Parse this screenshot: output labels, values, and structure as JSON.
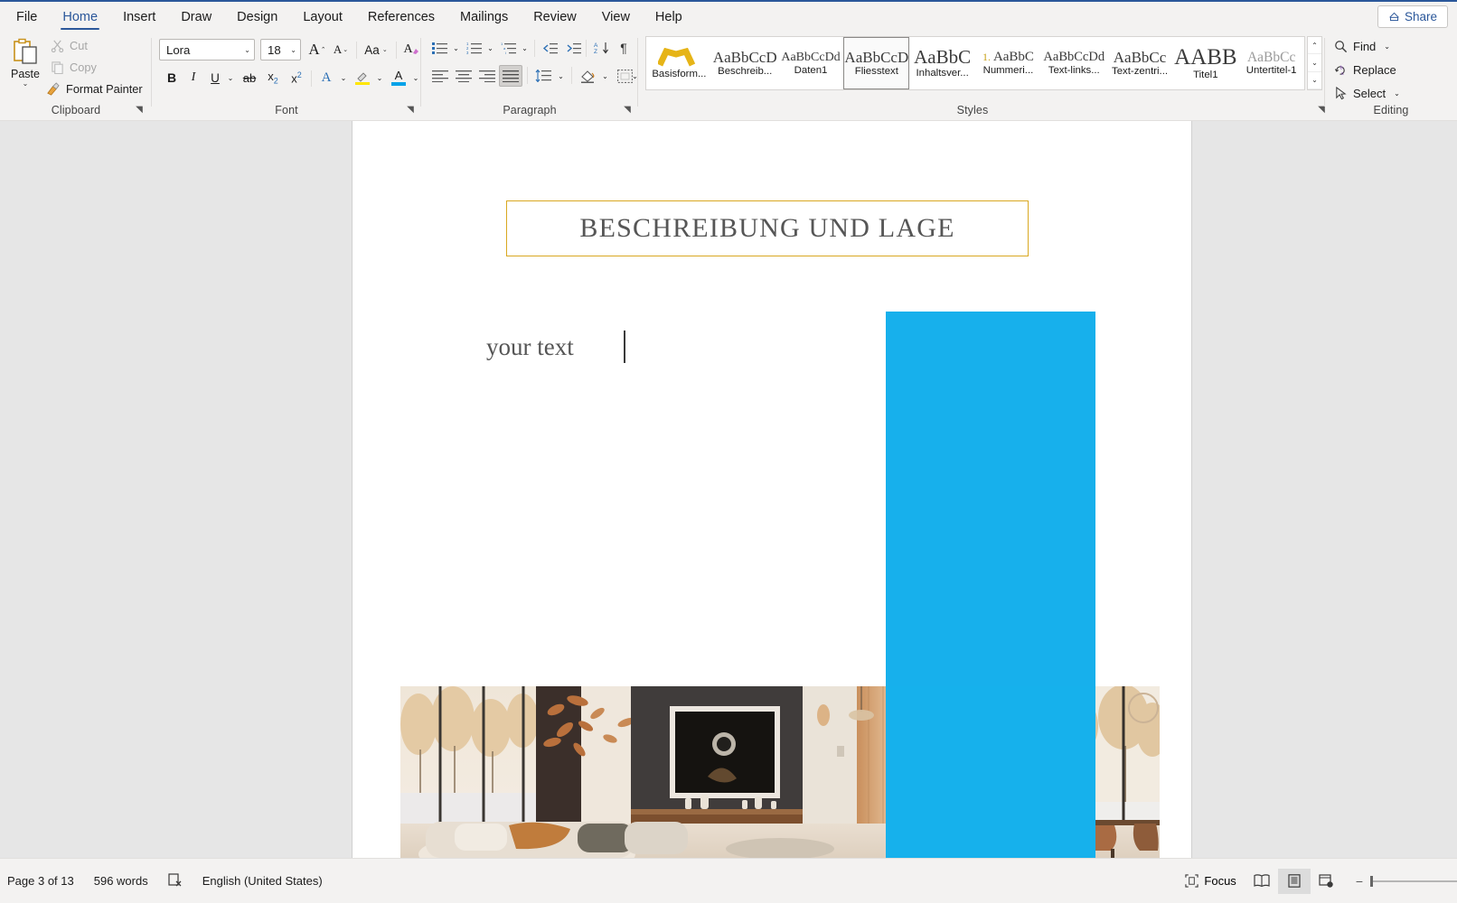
{
  "titlebar": {
    "tabs": [
      {
        "label": "File",
        "active": false
      },
      {
        "label": "Home",
        "active": true
      },
      {
        "label": "Insert",
        "active": false
      },
      {
        "label": "Draw",
        "active": false
      },
      {
        "label": "Design",
        "active": false
      },
      {
        "label": "Layout",
        "active": false
      },
      {
        "label": "References",
        "active": false
      },
      {
        "label": "Mailings",
        "active": false
      },
      {
        "label": "Review",
        "active": false
      },
      {
        "label": "View",
        "active": false
      },
      {
        "label": "Help",
        "active": false
      }
    ],
    "share_label": "Share"
  },
  "ribbon": {
    "clipboard": {
      "group_label": "Clipboard",
      "paste_label": "Paste",
      "cut_label": "Cut",
      "copy_label": "Copy",
      "format_painter_label": "Format Painter"
    },
    "font": {
      "group_label": "Font",
      "font_name": "Lora",
      "font_size": "18",
      "grow_label": "A",
      "shrink_label": "A",
      "change_case_label": "Aa",
      "clear_formatting_label": "A",
      "bold_label": "B",
      "italic_label": "I",
      "underline_label": "U",
      "strikethrough_label": "ab",
      "subscript_label": "x",
      "superscript_label": "x",
      "text_effects_label": "A",
      "highlight_label": "",
      "font_color_label": "A",
      "highlight_color": "#ffe600",
      "font_color": "#00a2e8"
    },
    "paragraph": {
      "group_label": "Paragraph",
      "bullets_label": "Bullets",
      "numbering_label": "Numbering",
      "multilevel_label": "Multilevel List",
      "decrease_indent_label": "Decrease Indent",
      "increase_indent_label": "Increase Indent",
      "sort_label": "Sort",
      "show_marks_label": "¶",
      "align_left_label": "Align Left",
      "center_label": "Center",
      "align_right_label": "Align Right",
      "justify_label": "Justify",
      "line_spacing_label": "Line and Paragraph Spacing",
      "shading_label": "Shading",
      "borders_label": "Borders",
      "selected_alignment": "justify"
    },
    "styles": {
      "group_label": "Styles",
      "items": [
        {
          "preview": "",
          "name": "Basisform...",
          "selected": false,
          "kind": "swatch"
        },
        {
          "preview": "AaBbCcD",
          "name": "Beschreib...",
          "selected": false,
          "size": "17px"
        },
        {
          "preview": "AaBbCcDd",
          "name": "Daten1",
          "selected": false,
          "size": "14px"
        },
        {
          "preview": "AaBbCcD",
          "name": "Fliesstext",
          "selected": true,
          "size": "17px"
        },
        {
          "preview": "AaBbC",
          "name": "Inhaltsver...",
          "selected": false,
          "size": "21px"
        },
        {
          "preview": "AaBbC",
          "name": "Nummeri...",
          "selected": false,
          "size": "15px",
          "prefix": "1."
        },
        {
          "preview": "AaBbCcDd",
          "name": "Text-links...",
          "selected": false,
          "size": "14.5px"
        },
        {
          "preview": "AaBbCc",
          "name": "Text-zentri...",
          "selected": false,
          "size": "17px"
        },
        {
          "preview": "AABB",
          "name": "Titel1",
          "selected": false,
          "size": "25px"
        },
        {
          "preview": "AaBbCc",
          "name": "Untertitel-1",
          "selected": false,
          "size": "15.5px"
        }
      ],
      "scroll_up": "⌃",
      "scroll_down": "⌄",
      "scroll_more": "⌄"
    },
    "editing": {
      "group_label": "Editing",
      "find_label": "Find",
      "replace_label": "Replace",
      "select_label": "Select"
    }
  },
  "document": {
    "heading": "BESCHREIBUNG UND LAGE",
    "heading_border_color": "#d9a821",
    "body_text": "your text",
    "overlay_color": "#17b0ec"
  },
  "statusbar": {
    "page_label": "Page 3 of 13",
    "word_count": "596 words",
    "proofing_icon_name": "proofing-errors-icon",
    "language": "English (United States)",
    "focus_label": "Focus",
    "read_mode_label": "Read Mode",
    "print_layout_label": "Print Layout",
    "web_layout_label": "Web Layout",
    "zoom_out_label": "−",
    "selected_view": "print_layout"
  }
}
